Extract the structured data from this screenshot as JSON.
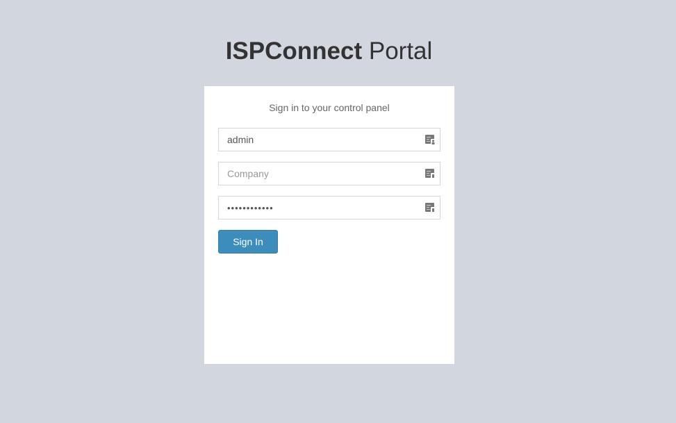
{
  "header": {
    "brand_bold": "ISPConnect",
    "brand_light": " Portal"
  },
  "login": {
    "message": "Sign in to your control panel",
    "username": {
      "value": "admin",
      "placeholder": "",
      "icon": "contact-card-icon"
    },
    "company": {
      "value": "",
      "placeholder": "Company",
      "icon": "contact-card-icon"
    },
    "password": {
      "value": "••••••••••••",
      "icon": "contact-card-icon"
    },
    "submit_label": "Sign In"
  },
  "colors": {
    "page_background": "#d2d6de",
    "panel_background": "#ffffff",
    "button_primary": "#3c8dbc",
    "button_border": "#367fa9",
    "icon_gray": "#777777"
  }
}
